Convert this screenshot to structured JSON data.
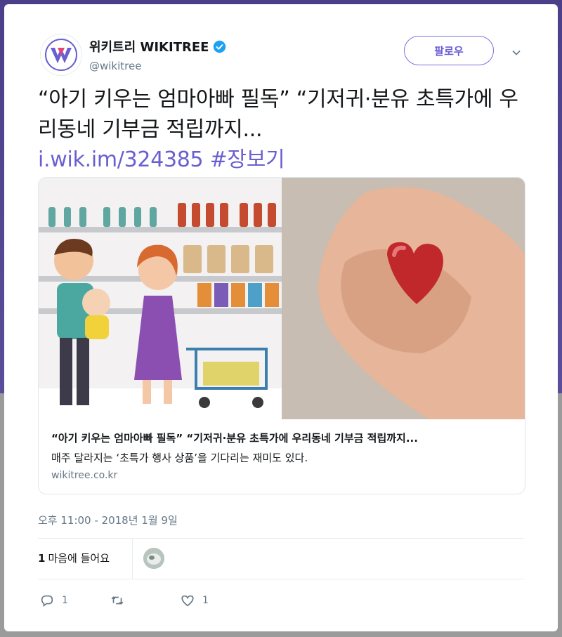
{
  "account": {
    "name": "위키트리 WIKITREE",
    "handle": "@wikitree",
    "verified": true
  },
  "follow_button": "팔로우",
  "tweet": {
    "text": "“아기 키우는 엄마아빠 필독” “기저귀·분유 초특가에 우리동네 기부금 적립까지...",
    "link": "i.wik.im/324385",
    "hashtag": "#장보기"
  },
  "card": {
    "title": "“아기 키우는 엄마아빠 필독” “기저귀·분유 초특가에 우리동네 기부금 적립까지...",
    "description": "매주 달라지는 ‘초특가 행사 상품’을 기다리는 재미도 있다.",
    "domain": "wikitree.co.kr"
  },
  "timestamp": "오후 11:00 - 2018년 1월 9일",
  "likes": {
    "count": "1",
    "label": "마음에 들어요"
  },
  "actions": {
    "reply_count": "1",
    "retweet_count": "",
    "like_count": "1"
  },
  "colors": {
    "accent": "#6b5fd6",
    "link": "#6a5fcf",
    "verified": "#1da1f2",
    "muted": "#657786"
  }
}
